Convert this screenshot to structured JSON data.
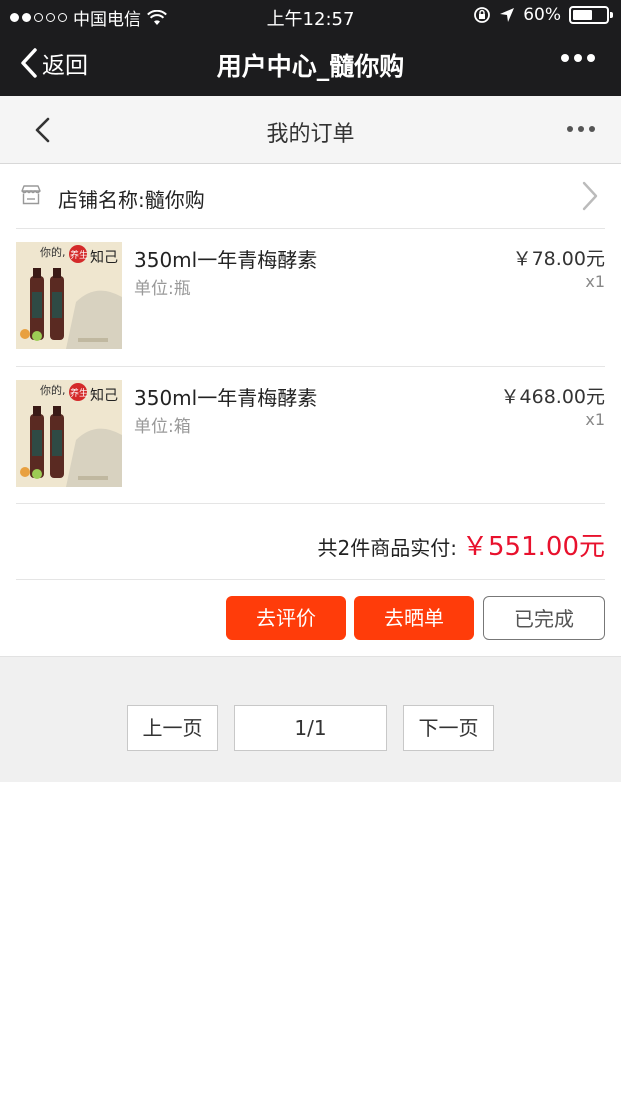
{
  "status_bar": {
    "carrier": "中国电信",
    "time": "上午12:57",
    "battery": "60%",
    "battery_level": 0.6,
    "signal_bars_filled": 2,
    "signal_bars_total": 5
  },
  "wechat_bar": {
    "back_label": "返回",
    "title": "用户中心_髓你购",
    "more_icon": "more-dots-icon"
  },
  "page_header": {
    "title": "我的订单",
    "back_icon": "chevron-left-icon",
    "more_icon": "more-dots-icon"
  },
  "order": {
    "shop_label": "店铺名称:髓你购",
    "shop_icon": "store-icon",
    "items": [
      {
        "name": "350ml一年青梅酵素",
        "unit": "单位:瓶",
        "price": "￥78.00元",
        "qty": "x1",
        "thumb_text_a": "你的,",
        "thumb_text_b": "养生",
        "thumb_text_c": "知己"
      },
      {
        "name": "350ml一年青梅酵素",
        "unit": "单位:箱",
        "price": "￥468.00元",
        "qty": "x1",
        "thumb_text_a": "你的,",
        "thumb_text_b": "养生",
        "thumb_text_c": "知己"
      }
    ],
    "total_label": "共2件商品实付:",
    "total_amount": "￥551.00元",
    "buttons": {
      "review": "去评价",
      "share": "去晒单",
      "completed": "已完成"
    }
  },
  "pagination": {
    "prev": "上一页",
    "page": "1/1",
    "next": "下一页"
  },
  "colors": {
    "accent_red": "#ff3c0a",
    "price_red": "#e8112d",
    "top_bar": "#1c1c1e"
  }
}
